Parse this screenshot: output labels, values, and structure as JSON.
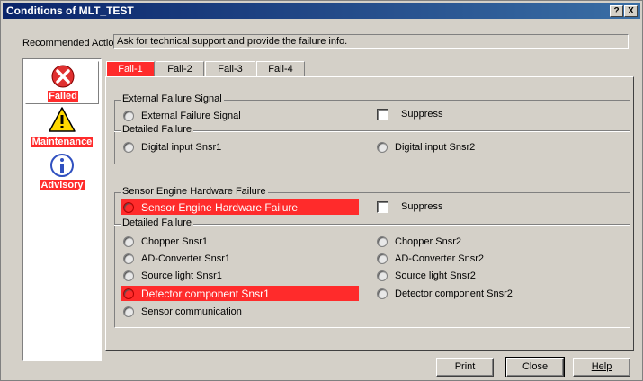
{
  "window": {
    "title": "Conditions of MLT_TEST",
    "help_btn": "?",
    "close_btn": "X"
  },
  "recommended": {
    "label": "Recommended Action:",
    "value": "Ask for technical support and provide the failure info."
  },
  "sidebar": {
    "items": [
      {
        "label": "Failed",
        "icon": "failed-x-icon",
        "color": "#e03030"
      },
      {
        "label": "Maintenance",
        "icon": "warning-icon",
        "color": "#ffd800"
      },
      {
        "label": "Advisory",
        "icon": "info-icon",
        "color": "#3050c0"
      }
    ]
  },
  "tabs": [
    "Fail-1",
    "Fail-2",
    "Fail-3",
    "Fail-4"
  ],
  "ext_group": {
    "title": "External Failure Signal",
    "signal": "External Failure Signal",
    "suppress": "Suppress",
    "detail_title": "Detailed Failure",
    "left": "Digital input Snsr1",
    "right": "Digital input Snsr2"
  },
  "sensor_group": {
    "title": "Sensor Engine Hardware Failure",
    "signal": "Sensor Engine Hardware Failure",
    "suppress": "Suppress",
    "detail_title": "Detailed Failure",
    "left": [
      "Chopper Snsr1",
      "AD-Converter Snsr1",
      "Source light Snsr1",
      "Detector component Snsr1",
      "Sensor communication"
    ],
    "right": [
      "Chopper Snsr2",
      "AD-Converter Snsr2",
      "Source light Snsr2",
      "Detector component Snsr2"
    ]
  },
  "buttons": {
    "print": "Print",
    "close": "Close",
    "help": "Help"
  },
  "colors": {
    "alarm": "#ff2b2b",
    "title_bar": "#0a246a",
    "face": "#d4d0c8"
  }
}
